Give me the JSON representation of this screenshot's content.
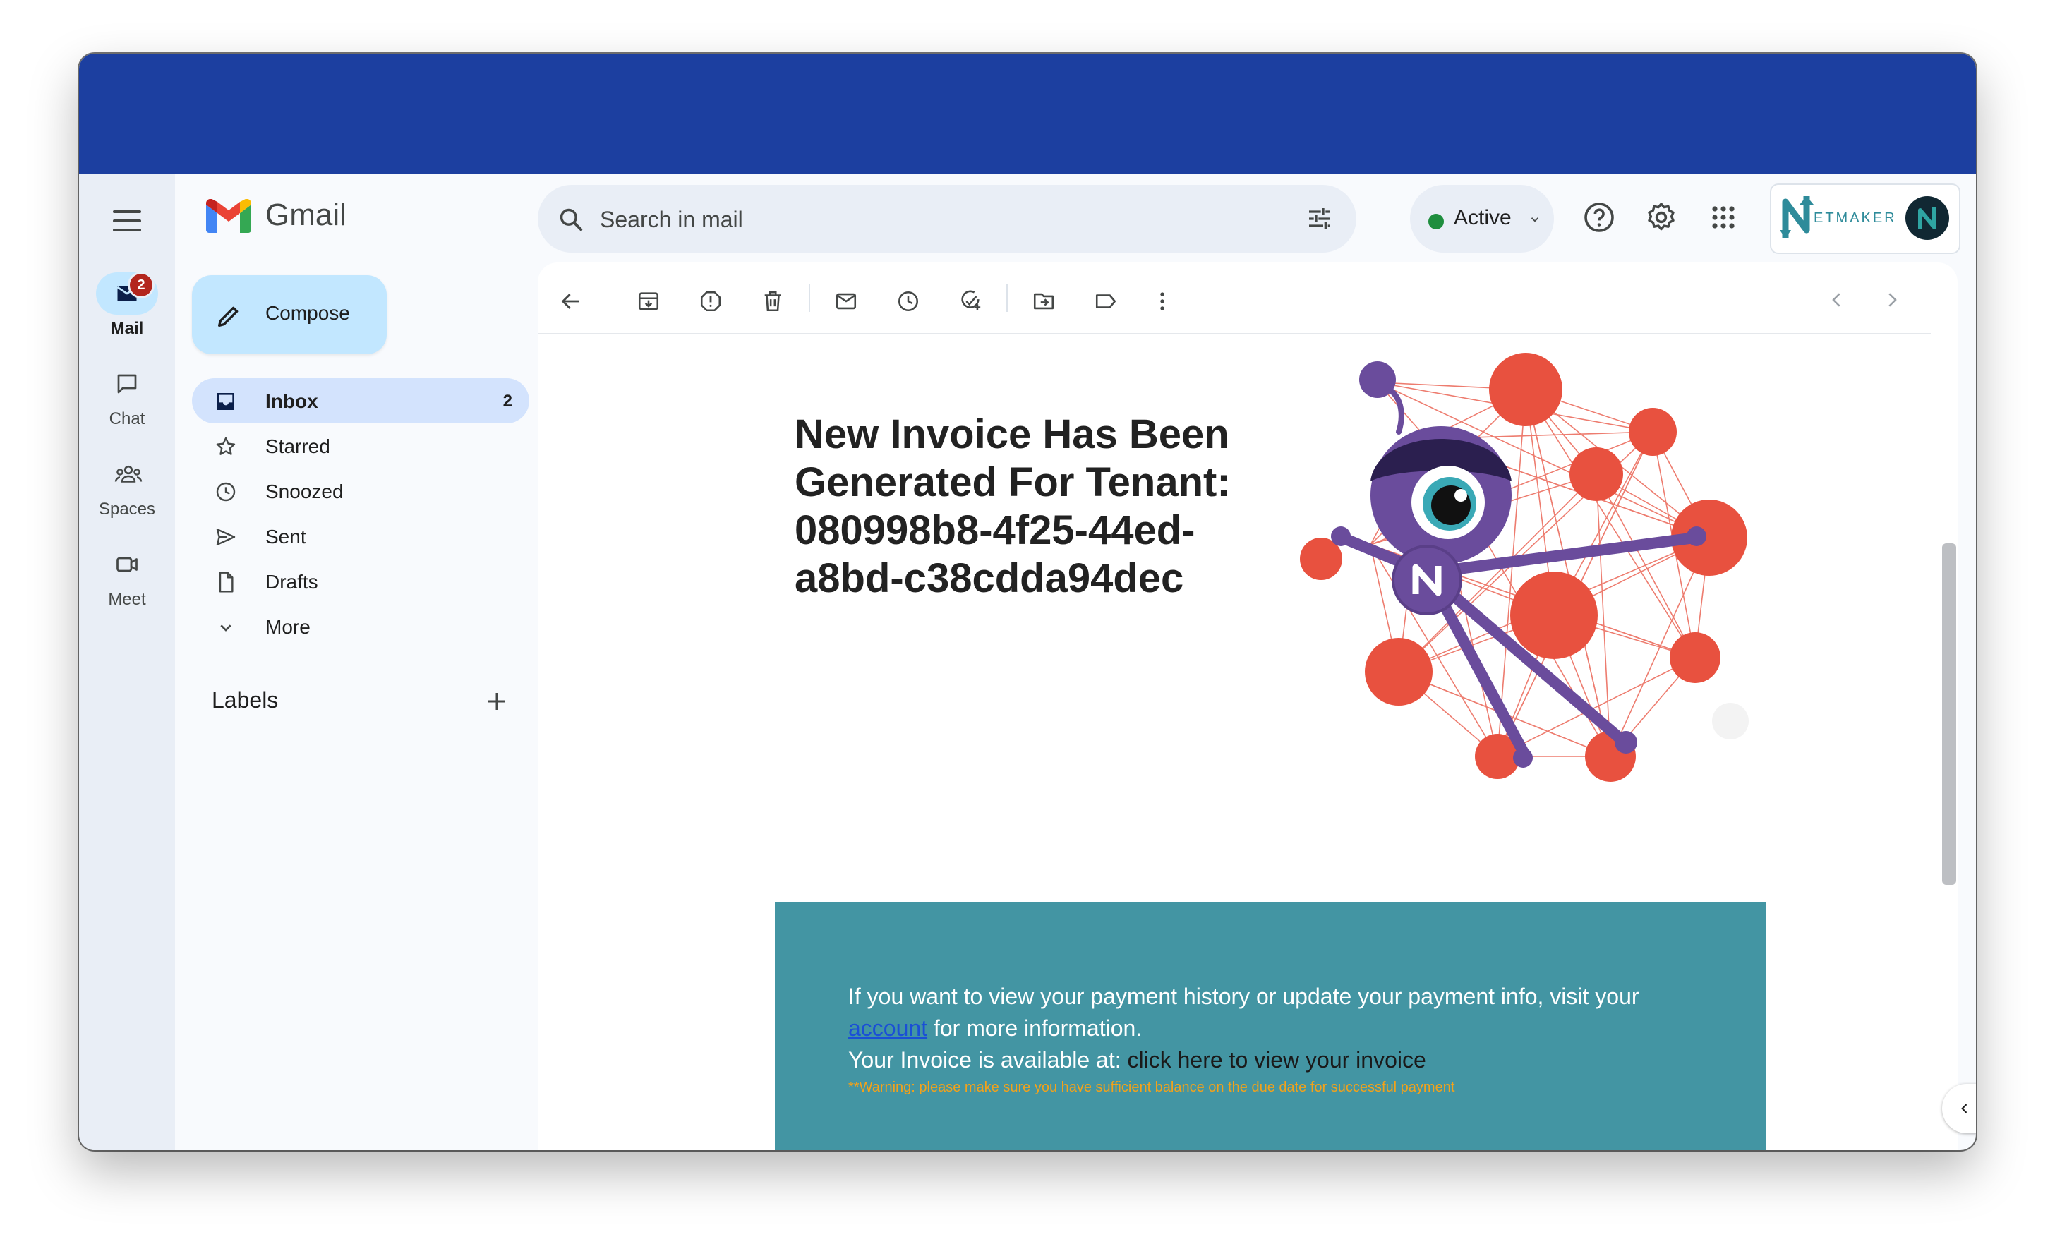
{
  "colors": {
    "topbar": "#1c3fa0",
    "rail_bg": "#e9eef6",
    "compose_bg": "#c2e7ff",
    "inbox_active_bg": "#d3e3fd",
    "badge_red": "#b3261e",
    "status_green": "#1e8e3e",
    "banner_teal": "#4395a3",
    "warning_orange": "#f3a21a",
    "link_blue": "#1a4fd6",
    "mascot_purple": "#6a4c9c",
    "node_red": "#e8513f"
  },
  "rail": {
    "menu_icon": "hamburger-icon",
    "items": [
      {
        "label": "Mail",
        "icon": "mail-icon",
        "badge": "2",
        "active": true
      },
      {
        "label": "Chat",
        "icon": "chat-icon"
      },
      {
        "label": "Spaces",
        "icon": "spaces-icon"
      },
      {
        "label": "Meet",
        "icon": "video-icon"
      }
    ]
  },
  "header": {
    "app_name": "Gmail",
    "search": {
      "placeholder": "Search in mail",
      "value": ""
    },
    "status": {
      "label": "Active"
    },
    "icons": [
      "help-icon",
      "settings-icon",
      "apps-grid-icon"
    ],
    "brand": {
      "wordmark": "ETMAKER"
    }
  },
  "nav": {
    "compose_label": "Compose",
    "items": [
      {
        "label": "Inbox",
        "count": "2",
        "icon": "inbox-icon",
        "active": true
      },
      {
        "label": "Starred",
        "icon": "star-icon"
      },
      {
        "label": "Snoozed",
        "icon": "clock-icon"
      },
      {
        "label": "Sent",
        "icon": "send-icon"
      },
      {
        "label": "Drafts",
        "icon": "draft-icon"
      },
      {
        "label": "More",
        "icon": "chevron-down-icon"
      }
    ],
    "labels_title": "Labels"
  },
  "toolbar": {
    "icons": [
      "back-arrow-icon",
      "archive-icon",
      "report-spam-icon",
      "delete-icon",
      "mark-unread-icon",
      "snooze-icon",
      "add-task-icon",
      "move-to-icon",
      "label-icon",
      "more-vert-icon",
      "prev-icon",
      "next-icon"
    ]
  },
  "email": {
    "title": "New Invoice Has Been Generated For Tenant: 080998b8-4f25-44ed-a8bd-c38cdda94dec",
    "banner": {
      "line1_pre": "If you want to view your payment history or update your payment info, visit your ",
      "link_text": "account",
      "line1_post": " for more information.",
      "line2_pre": "Your Invoice is available at: ",
      "line2_link": "click here to view your invoice",
      "warning": "**Warning: please make sure you have sufficient balance on the due date for successful payment"
    }
  }
}
